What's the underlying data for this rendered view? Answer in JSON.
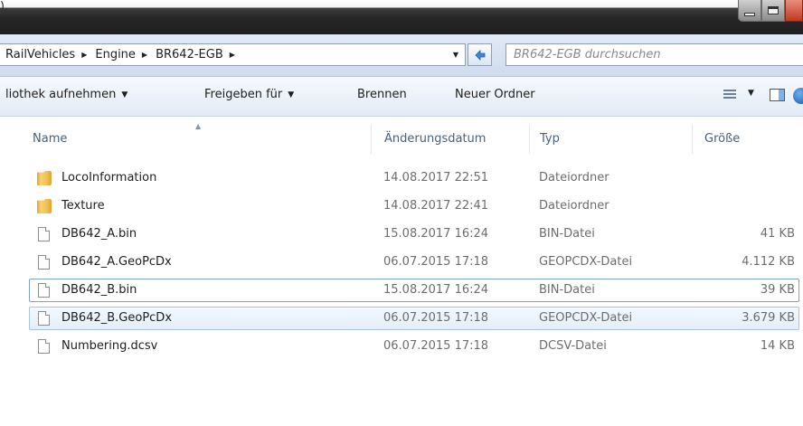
{
  "titlebar": {
    "brace": "),"
  },
  "breadcrumb": [
    {
      "label": "RailVehicles"
    },
    {
      "label": "Engine"
    },
    {
      "label": "BR642-EGB"
    }
  ],
  "search": {
    "placeholder": "BR642-EGB durchsuchen"
  },
  "toolbar": {
    "library_label": "liothek aufnehmen",
    "share_label": "Freigeben für",
    "burn_label": "Brennen",
    "new_folder_label": "Neuer Ordner"
  },
  "columns": {
    "name": "Name",
    "date": "Änderungsdatum",
    "type": "Typ",
    "size": "Größe"
  },
  "files": [
    {
      "name": "LocoInformation",
      "date": "14.08.2017 22:51",
      "type": "Dateiordner",
      "size": "",
      "kind": "folder"
    },
    {
      "name": "Texture",
      "date": "14.08.2017 22:41",
      "type": "Dateiordner",
      "size": "",
      "kind": "folder"
    },
    {
      "name": "DB642_A.bin",
      "date": "15.08.2017 16:24",
      "type": "BIN-Datei",
      "size": "41 KB",
      "kind": "file"
    },
    {
      "name": "DB642_A.GeoPcDx",
      "date": "06.07.2015 17:18",
      "type": "GEOPCDX-Datei",
      "size": "4.112 KB",
      "kind": "file"
    },
    {
      "name": "DB642_B.bin",
      "date": "15.08.2017 16:24",
      "type": "BIN-Datei",
      "size": "39 KB",
      "kind": "file"
    },
    {
      "name": "DB642_B.GeoPcDx",
      "date": "06.07.2015 17:18",
      "type": "GEOPCDX-Datei",
      "size": "3.679 KB",
      "kind": "file"
    },
    {
      "name": "Numbering.dcsv",
      "date": "06.07.2015 17:18",
      "type": "DCSV-Datei",
      "size": "14 KB",
      "kind": "file"
    }
  ],
  "colors": {
    "selection_border": "#7da2ce",
    "hover_fill": "#e4eefb",
    "header_text": "#4c607a"
  }
}
